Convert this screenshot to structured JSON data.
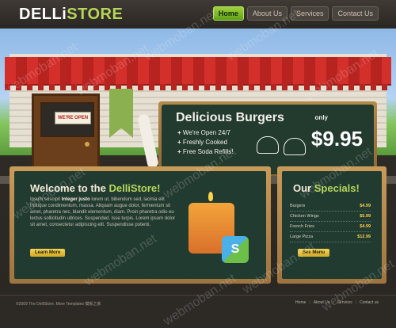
{
  "header": {
    "logo_part1": "DELLi",
    "logo_part2": "STORE",
    "nav": [
      {
        "label": "Home",
        "active": true
      },
      {
        "label": "About Us",
        "active": false
      },
      {
        "label": "Services",
        "active": false
      },
      {
        "label": "Contact Us",
        "active": false
      }
    ]
  },
  "storefront": {
    "door_sign": "WE'RE OPEN"
  },
  "chalkboard": {
    "title": "Delicious Burgers",
    "features": [
      "We're Open 24/7",
      "Freshly Cooked",
      "Free Soda Refills!"
    ],
    "price_prefix": "only",
    "price": "$9.95"
  },
  "welcome": {
    "title_prefix": "Welcome to the",
    "title_highlight": "DelliStore!",
    "body_intro": "Ipsum suscipit",
    "body_strong": "Integer justo",
    "body_text": "lorem ut, bibendum sed, lacinia elit tristique condimentum, massa. Aliquam augue dolor, fermentum sit amet, pharetra nec, blandit elementum, diam. Proin pharetra odio eu lectus sollicitudin ultrices. Suspended. Isse turpis. Lorem ipsum dolor sit amet, consectetur adipiscing elit. Suspendisse potenti.",
    "button_label": "Learn More"
  },
  "specials": {
    "title_prefix": "Our",
    "title_highlight": "Specials!",
    "items": [
      {
        "name": "Burgers",
        "price": "$4.99"
      },
      {
        "name": "Chicken Wings",
        "price": "$5.99"
      },
      {
        "name": "French Fries",
        "price": "$4.99"
      },
      {
        "name": "Large Pizza",
        "price": "$12.99"
      }
    ],
    "button_label": "See Menu"
  },
  "footer": {
    "copyright": "©2009 The DelliStore. More Templates 模板之家",
    "links": [
      "Home",
      "About Us",
      "Services",
      "Contact us"
    ]
  },
  "watermark": "webmoban.net",
  "colors": {
    "accent_green": "#b7d65b",
    "price_yellow": "#ffd04a",
    "awning_red": "#d32f2b",
    "board_green": "#223b31",
    "frame_gold": "#c89b59"
  }
}
